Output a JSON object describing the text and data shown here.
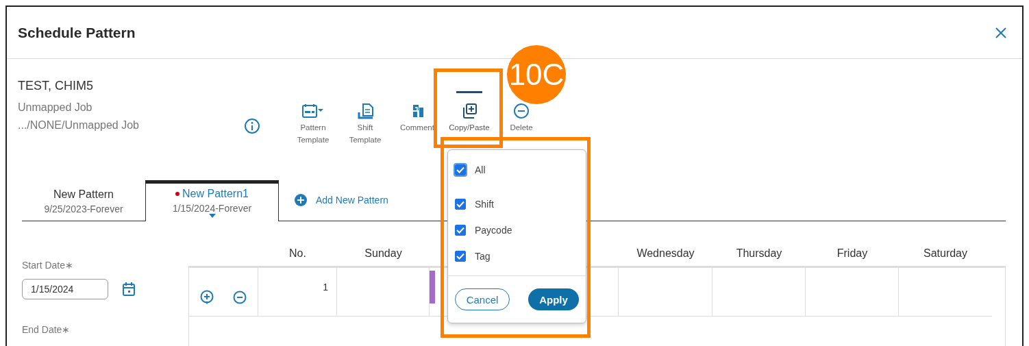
{
  "dialog": {
    "title": "Schedule Pattern"
  },
  "employee": {
    "name": "TEST, CHIM5",
    "job": "Unmapped Job",
    "job_path": ".../NONE/Unmapped Job"
  },
  "toolbar": [
    {
      "kind": "pattern-template",
      "label": "Pattern Template",
      "selected": false
    },
    {
      "kind": "shift-template",
      "label": "Shift Template",
      "selected": false
    },
    {
      "kind": "comment",
      "label": "Comment",
      "selected": false
    },
    {
      "kind": "copy-paste",
      "label": "Copy/Paste",
      "selected": true
    },
    {
      "kind": "delete",
      "label": "Delete",
      "selected": false
    }
  ],
  "tabs": [
    {
      "name": "New Pattern",
      "dates": "9/25/2023-Forever",
      "selected": false,
      "modified": false
    },
    {
      "name": "New Pattern1",
      "dates": "1/15/2024-Forever",
      "selected": true,
      "modified": true
    }
  ],
  "add_pattern": "Add New Pattern",
  "start_date": {
    "label": "Start Date∗",
    "value": "1/15/2024"
  },
  "end_date": {
    "label": "End Date∗"
  },
  "grid": {
    "columns": [
      {
        "kind": "actions"
      },
      {
        "kind": "no",
        "label": "No."
      },
      {
        "kind": "day",
        "label": "Sunday"
      },
      {
        "kind": "day"
      },
      {
        "kind": "day"
      },
      {
        "kind": "day",
        "label": "Wednesday"
      },
      {
        "kind": "day",
        "label": "Thursday"
      },
      {
        "kind": "day",
        "label": "Friday"
      },
      {
        "kind": "day",
        "label": "Saturday"
      }
    ],
    "rows": [
      {
        "no": "1",
        "cells": [
          {
            "kind": "empty"
          },
          {
            "kind": "shift"
          },
          {
            "kind": "empty"
          },
          {
            "kind": "empty"
          },
          {
            "kind": "empty"
          },
          {
            "kind": "empty"
          },
          {
            "kind": "empty"
          }
        ]
      }
    ]
  },
  "copy_popup": {
    "options": [
      {
        "kind": "all",
        "label": "All",
        "checked": true
      },
      {
        "kind": "item",
        "label": "Shift",
        "checked": true
      },
      {
        "kind": "item",
        "label": "Paycode",
        "checked": true
      },
      {
        "kind": "item",
        "label": "Tag",
        "checked": true
      }
    ],
    "cancel": "Cancel",
    "apply": "Apply"
  },
  "callout": {
    "badge": "10C"
  }
}
